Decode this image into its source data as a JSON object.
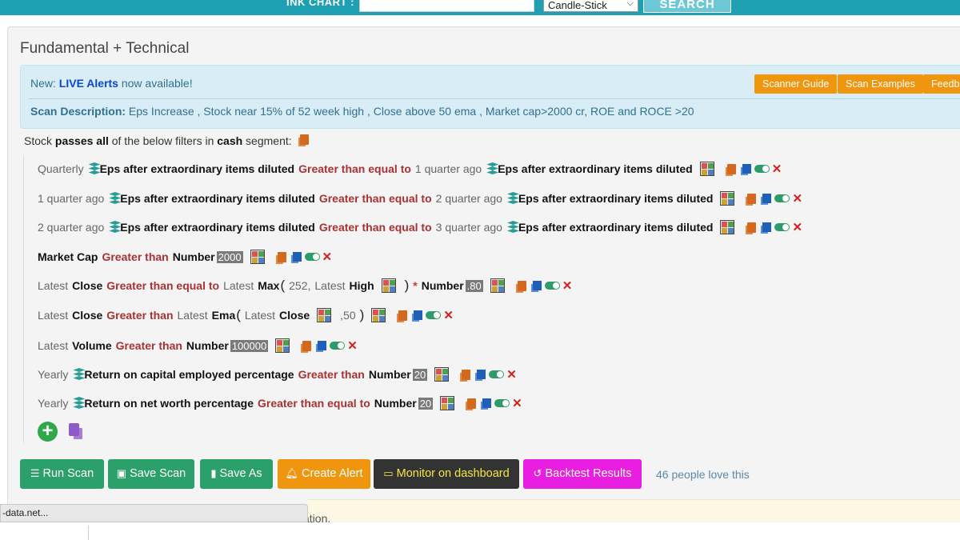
{
  "topbar": {
    "label": "INK CHART :",
    "chart_input_value": "",
    "chart_type": "Candle-Stick",
    "search_label": "SEARCH"
  },
  "page_title": "Fundamental + Technical",
  "info": {
    "new_prefix": "New: ",
    "live_alerts": "LIVE Alerts",
    "new_suffix": " now available!",
    "scanner_guide": "Scanner Guide",
    "scan_examples": "Scan Examples",
    "feedback": "Feedb",
    "scan_desc_label": "Scan Description:",
    "scan_desc_text": " Eps Increase , Stock near 15% of 52 week high , Close above 50 ema , Market cap>2000 cr, ROE and ROCE >20"
  },
  "passes": {
    "p1": "Stock ",
    "p2": "passes all",
    "p3": " of the below filters in ",
    "p4": "cash",
    "p5": " segment:"
  },
  "rules": [
    {
      "a": "Quarterly",
      "b": "Eps after extraordinary items diluted",
      "op": "Greater than equal to",
      "c": "1 quarter ago",
      "d": "Eps after extraordinary items diluted"
    },
    {
      "a": "1 quarter ago",
      "b": "Eps after extraordinary items diluted",
      "op": "Greater than equal to",
      "c": "2 quarter ago",
      "d": "Eps after extraordinary items diluted"
    },
    {
      "a": "2 quarter ago",
      "b": "Eps after extraordinary items diluted",
      "op": "Greater than equal to",
      "c": "3 quarter ago",
      "d": "Eps after extraordinary items diluted"
    },
    {
      "b": "Market Cap",
      "op": "Greater than",
      "num_label": "Number",
      "num": "2000"
    },
    {
      "a": "Latest",
      "b": "Close",
      "op": "Greater than equal to",
      "c": "Latest",
      "fn": "Max",
      "p1": "252,",
      "p2": "Latest",
      "p3": "High",
      "close": ")",
      "star": "*",
      "num_label": "Number",
      "num": ".80"
    },
    {
      "a": "Latest",
      "b": "Close",
      "op": "Greater than",
      "c": "Latest",
      "fn": "Ema",
      "p2": "Latest",
      "p3": "Close",
      "p4": ",50",
      "close": ")"
    },
    {
      "a": "Latest",
      "b": "Volume",
      "op": "Greater than",
      "num_label": "Number",
      "num": "100000"
    },
    {
      "a": "Yearly",
      "b": "Return on capital employed percentage",
      "op": "Greater than",
      "num_label": "Number",
      "num": "20"
    },
    {
      "a": "Yearly",
      "b": "Return on net worth percentage",
      "op": "Greater than equal to",
      "num_label": "Number",
      "num": "20"
    }
  ],
  "actions": {
    "run_scan": "Run Scan",
    "save_scan": "Save Scan",
    "save_as": "Save As",
    "create_alert": "Create Alert",
    "monitor": "Monitor on dashboard",
    "backtest": "Backtest Results",
    "love": "46 people love this"
  },
  "bottom_note": "ation.",
  "status_bar": "-data.net...",
  "colors": {
    "topbar": "#1ea0b2",
    "operator": "#a83232",
    "green_button": "#2ca06a",
    "orange_button": "#f0960e",
    "dark_button": "#333333",
    "magenta_button": "#e81ee0"
  }
}
